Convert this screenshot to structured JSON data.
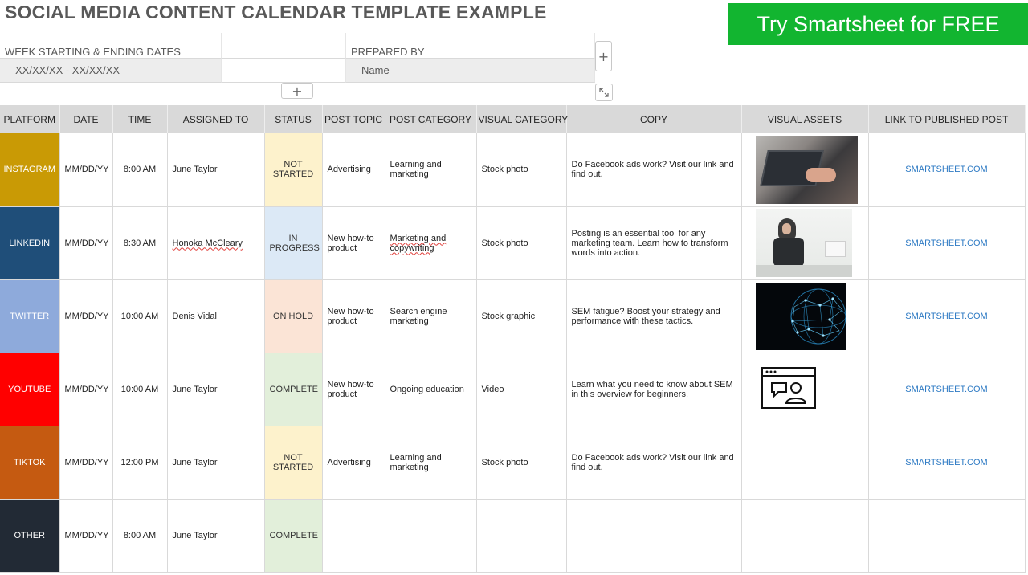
{
  "page": {
    "title": "SOCIAL MEDIA CONTENT CALENDAR TEMPLATE EXAMPLE"
  },
  "cta": {
    "label": "Try Smartsheet for FREE",
    "color": "#12b530"
  },
  "header_fields": {
    "week_label": "WEEK STARTING & ENDING DATES",
    "week_value": "XX/XX/XX - XX/XX/XX",
    "prepared_label": "PREPARED BY",
    "prepared_value": "Name"
  },
  "controls": {
    "add_column_icon": "plus-icon",
    "add_row_icon": "plus-icon",
    "expand_icon": "expand-icon"
  },
  "table": {
    "columns": [
      "PLATFORM",
      "DATE",
      "TIME",
      "ASSIGNED TO",
      "STATUS",
      "POST TOPIC",
      "POST CATEGORY",
      "VISUAL CATEGORY",
      "COPY",
      "VISUAL ASSETS",
      "LINK TO PUBLISHED POST"
    ],
    "rows": [
      {
        "platform": "INSTAGRAM",
        "platform_color": "#c99a05",
        "date": "MM/DD/YY",
        "time": "8:00 AM",
        "assigned": "June Taylor",
        "status": "NOT STARTED",
        "status_color": "#fdf2cc",
        "topic": "Advertising",
        "category": "Learning and marketing",
        "visual_category": "Stock photo",
        "copy": "Do Facebook ads work? Visit our link and find out.",
        "asset": "laptop-photo",
        "link": "SMARTSHEET.COM"
      },
      {
        "platform": "LINKEDIN",
        "platform_color": "#1f4e79",
        "date": "MM/DD/YY",
        "time": "8:30 AM",
        "assigned": "Honoka McCleary",
        "status": "IN PROGRESS",
        "status_color": "#dce9f6",
        "topic": "New how-to product",
        "category": "Marketing and copywriting",
        "visual_category": "Stock photo",
        "copy": "Posting is an essential tool for any marketing team. Learn how to transform words into action.",
        "asset": "office-photo",
        "link": "SMARTSHEET.COM"
      },
      {
        "platform": "TWITTER",
        "platform_color": "#8eaadb",
        "date": "MM/DD/YY",
        "time": "10:00 AM",
        "assigned": "Denis Vidal",
        "status": "ON HOLD",
        "status_color": "#fbe4d6",
        "topic": "New how-to product",
        "category": "Search engine marketing",
        "visual_category": "Stock graphic",
        "copy": "SEM fatigue? Boost your strategy and performance with these tactics.",
        "asset": "globe-graphic",
        "link": "SMARTSHEET.COM"
      },
      {
        "platform": "YOUTUBE",
        "platform_color": "#ff0000",
        "date": "MM/DD/YY",
        "time": "10:00 AM",
        "assigned": "June Taylor",
        "status": "COMPLETE",
        "status_color": "#e2efda",
        "topic": "New how-to product",
        "category": "Ongoing education",
        "visual_category": "Video",
        "copy": "Learn what you need to know about SEM in this overview for beginners.",
        "asset": "video-chat-icon",
        "link": "SMARTSHEET.COM"
      },
      {
        "platform": "TIKTOK",
        "platform_color": "#c55a11",
        "date": "MM/DD/YY",
        "time": "12:00 PM",
        "assigned": "June Taylor",
        "status": "NOT STARTED",
        "status_color": "#fdf2cc",
        "topic": "Advertising",
        "category": "Learning and marketing",
        "visual_category": "Stock photo",
        "copy": "Do Facebook ads work? Visit our link and find out.",
        "asset": "",
        "link": "SMARTSHEET.COM"
      },
      {
        "platform": "OTHER",
        "platform_color": "#222a35",
        "date": "MM/DD/YY",
        "time": "8:00 AM",
        "assigned": "June Taylor",
        "status": "COMPLETE",
        "status_color": "#e2efda",
        "topic": "",
        "category": "",
        "visual_category": "",
        "copy": "",
        "asset": "",
        "link": ""
      }
    ]
  }
}
